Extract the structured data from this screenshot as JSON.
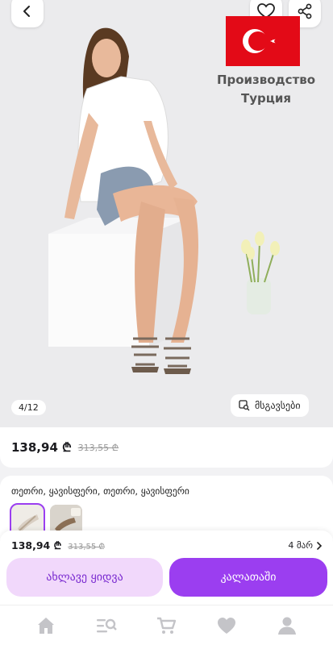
{
  "gallery": {
    "origin_line1": "Производство",
    "origin_line2": "Турция",
    "counter": "4/12",
    "similar_label": "მსგავსები"
  },
  "price": {
    "current": "138,94 ₾",
    "old": "313,55 ₾"
  },
  "variants": {
    "colors_text": "თეთრი, ყავისფერი, თეთრი, ყავისფერი"
  },
  "buy_sheet": {
    "price": "138,94 ₾",
    "old_price": "313,55 ₾",
    "installments": "4 მარ",
    "buy_now_label": "ახლავე ყიდვა",
    "cart_label": "კალათაში"
  },
  "nav": {
    "items": [
      "home-icon",
      "catalog-search-icon",
      "cart-icon",
      "favorites-icon",
      "profile-icon"
    ]
  },
  "colors": {
    "accent": "#9b3ef0",
    "accent_light": "#f1d8fb",
    "flag_red": "#e30a17"
  }
}
